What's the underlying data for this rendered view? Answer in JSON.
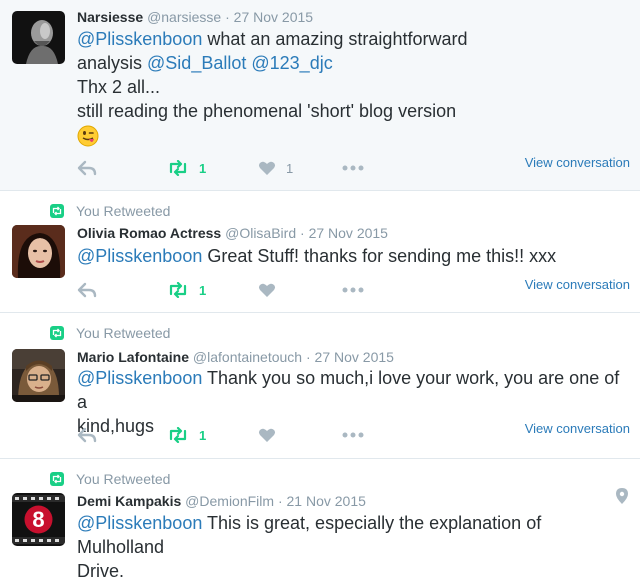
{
  "colors": {
    "mention": "#2b7bb9",
    "retweet": "#19cf86",
    "muted": "#8899a6",
    "highlight_bg": "#f5f8fa"
  },
  "tweets": [
    {
      "retweet_context": "",
      "name": "Narsiesse",
      "handle": "@narsiesse",
      "separator": "·",
      "time": "27 Nov 2015",
      "mention": "@Plisskenboon",
      "text_line1": " what an amazing straightforward",
      "text_line2_pre": "analysis ",
      "mention2": "@Sid_Ballot",
      "mention3": "@123_djc",
      "text_line3": "Thx 2 all...",
      "text_line4": "still reading the phenomenal 'short' blog version",
      "emoji": "winking-face-with-tongue",
      "retweet_count": "1",
      "like_count": "1",
      "view_conversation": "View conversation"
    },
    {
      "retweet_context": "You Retweeted",
      "name": "Olivia Romao Actress",
      "handle": "@OlisaBird",
      "separator": "·",
      "time": "27 Nov 2015",
      "mention": "@Plisskenboon",
      "text": " Great Stuff! thanks for sending me this!!  xxx",
      "retweet_count": "1",
      "view_conversation": "View conversation"
    },
    {
      "retweet_context": "You Retweeted",
      "name": "Mario Lafontaine",
      "handle": "@lafontainetouch",
      "separator": "·",
      "time": "27 Nov 2015",
      "mention": "@Plisskenboon",
      "text_line1": " Thank you so much,i love your work, you are one of a",
      "text_line2": "kind,hugs",
      "retweet_count": "1",
      "view_conversation": "View conversation"
    },
    {
      "retweet_context": "You Retweeted",
      "name": "Demi Kampakis",
      "handle": "@DemionFilm",
      "separator": "·",
      "time": "21 Nov 2015",
      "mention": "@Plisskenboon",
      "text_line1": " This is great, especially the explanation of Mulholland",
      "text_line2": "Drive.",
      "avatar_glyph": "8"
    }
  ]
}
